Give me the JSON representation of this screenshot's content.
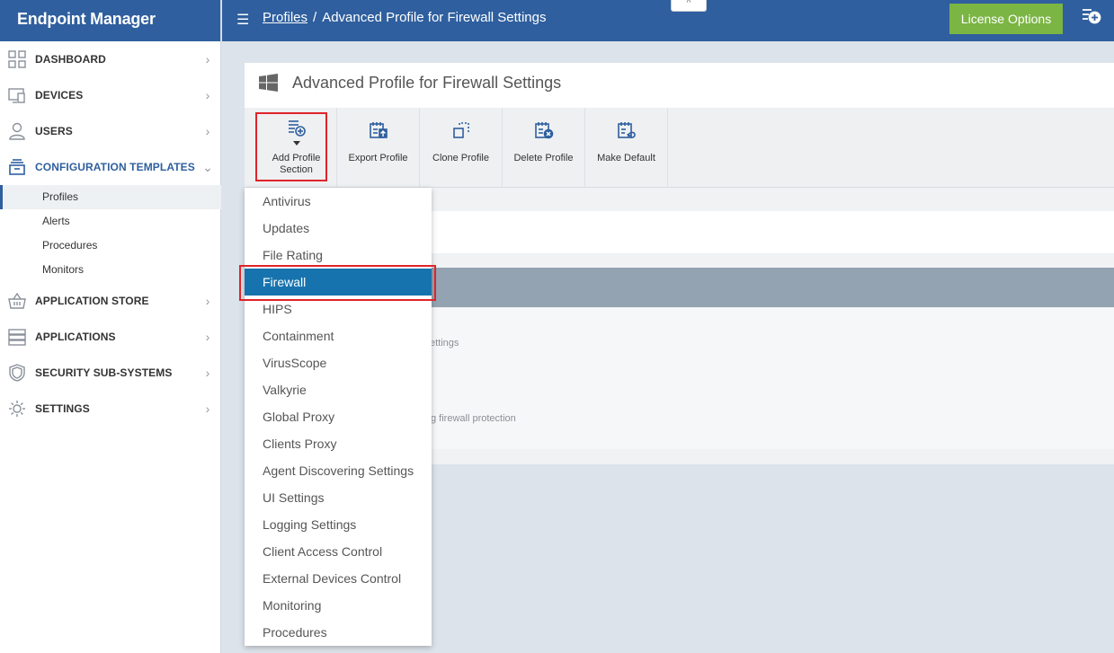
{
  "app": {
    "title": "Endpoint Manager"
  },
  "sidebar": {
    "items": [
      {
        "label": "DASHBOARD",
        "icon": "grid-icon"
      },
      {
        "label": "DEVICES",
        "icon": "monitor-icon"
      },
      {
        "label": "USERS",
        "icon": "user-icon"
      },
      {
        "label": "CONFIGURATION TEMPLATES",
        "icon": "stack-icon",
        "expanded": true
      },
      {
        "label": "APPLICATION STORE",
        "icon": "basket-icon"
      },
      {
        "label": "APPLICATIONS",
        "icon": "server-icon"
      },
      {
        "label": "SECURITY SUB-SYSTEMS",
        "icon": "shield-icon"
      },
      {
        "label": "SETTINGS",
        "icon": "gear-icon"
      }
    ],
    "sub_items": [
      "Profiles",
      "Alerts",
      "Procedures",
      "Monitors"
    ],
    "selected_sub": "Profiles"
  },
  "topbar": {
    "breadcrumb_link": "Profiles",
    "breadcrumb_sep": "/",
    "breadcrumb_current": "Advanced Profile for Firewall Settings",
    "license_label": "License Options",
    "collapse_glyph": "^"
  },
  "panel": {
    "title": "Advanced Profile for Firewall Settings",
    "toolbar": {
      "add_label_line1": "Add Profile",
      "add_label_line2": "Section",
      "export_label": "Export Profile",
      "clone_label": "Clone Profile",
      "delete_label": "Delete Profile",
      "default_label": "Make Default"
    },
    "partial_text_1": "ettings",
    "partial_text_2": "g firewall protection"
  },
  "dropdown": {
    "items": [
      "Antivirus",
      "Updates",
      "File Rating",
      "Firewall",
      "HIPS",
      "Containment",
      "VirusScope",
      "Valkyrie",
      "Global Proxy",
      "Clients Proxy",
      "Agent Discovering Settings",
      "UI Settings",
      "Logging Settings",
      "Client Access Control",
      "External Devices Control",
      "Monitoring",
      "Procedures"
    ],
    "active": "Firewall"
  },
  "colors": {
    "brand_blue": "#2f5f9e",
    "license_green": "#7bb544",
    "active_item": "#1773ad",
    "highlight_red": "#e0232a"
  }
}
